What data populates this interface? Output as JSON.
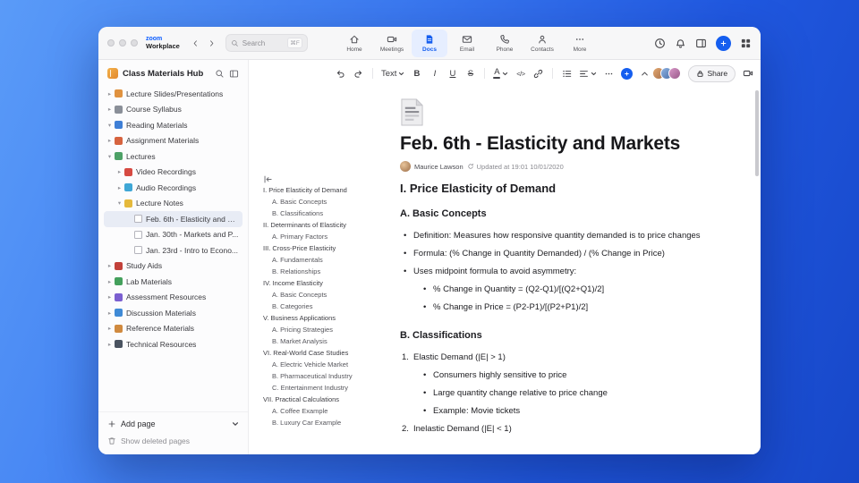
{
  "titlebar": {
    "brand_top": "zoom",
    "brand_bottom": "Workplace",
    "search": {
      "placeholder": "Search",
      "shortcut": "⌘F"
    },
    "tabs": [
      {
        "label": "Home"
      },
      {
        "label": "Meetings"
      },
      {
        "label": "Docs"
      },
      {
        "label": "Email"
      },
      {
        "label": "Phone"
      },
      {
        "label": "Contacts"
      },
      {
        "label": "More"
      }
    ]
  },
  "sidebar": {
    "title": "Class Materials Hub",
    "items": [
      {
        "label": "Lecture Slides/Presentations",
        "level": 0,
        "chevron": "collapsed",
        "icon": "presentation",
        "icon_color": "#e0923f",
        "selected": false
      },
      {
        "label": "Course Syllabus",
        "level": 0,
        "chevron": "collapsed",
        "icon": "syllabus",
        "icon_color": "#8a8f98",
        "selected": false
      },
      {
        "label": "Reading Materials",
        "level": 0,
        "chevron": "expanded",
        "icon": "reading-book",
        "icon_color": "#3f7fd6",
        "selected": false
      },
      {
        "label": "Assignment Materials",
        "level": 0,
        "chevron": "collapsed",
        "icon": "assignment",
        "icon_color": "#d6633f",
        "selected": false
      },
      {
        "label": "Lectures",
        "level": 0,
        "chevron": "expanded",
        "icon": "lectures",
        "icon_color": "#4da167",
        "selected": false
      },
      {
        "label": "Video Recordings",
        "level": 1,
        "chevron": "collapsed",
        "icon": "video",
        "icon_color": "#d64a42",
        "selected": false
      },
      {
        "label": "Audio Recordings",
        "level": 1,
        "chevron": "collapsed",
        "icon": "audio",
        "icon_color": "#3fa7d6",
        "selected": false
      },
      {
        "label": "Lecture Notes",
        "level": 1,
        "chevron": "expanded",
        "icon": "notes",
        "icon_color": "#e5b93c",
        "selected": false
      },
      {
        "label": "Feb. 6th - Elasticity and M...",
        "level": 2,
        "chevron": "none",
        "icon": "page",
        "icon_color": "#ffffff",
        "selected": true
      },
      {
        "label": "Jan. 30th - Markets and P...",
        "level": 2,
        "chevron": "none",
        "icon": "page",
        "icon_color": "#ffffff",
        "selected": false
      },
      {
        "label": "Jan. 23rd - Intro to Econo...",
        "level": 2,
        "chevron": "none",
        "icon": "page",
        "icon_color": "#ffffff",
        "selected": false
      },
      {
        "label": "Study Aids",
        "level": 0,
        "chevron": "collapsed",
        "icon": "study-aids",
        "icon_color": "#c2413a",
        "selected": false
      },
      {
        "label": "Lab Materials",
        "level": 0,
        "chevron": "collapsed",
        "icon": "lab",
        "icon_color": "#44a05c",
        "selected": false
      },
      {
        "label": "Assessment Resources",
        "level": 0,
        "chevron": "collapsed",
        "icon": "assessment",
        "icon_color": "#7b5fd0",
        "selected": false
      },
      {
        "label": "Discussion Materials",
        "level": 0,
        "chevron": "collapsed",
        "icon": "discussion",
        "icon_color": "#3f8ad6",
        "selected": false
      },
      {
        "label": "Reference Materials",
        "level": 0,
        "chevron": "collapsed",
        "icon": "reference",
        "icon_color": "#d08a3f",
        "selected": false
      },
      {
        "label": "Technical Resources",
        "level": 0,
        "chevron": "collapsed",
        "icon": "technical",
        "icon_color": "#4a5360",
        "selected": false
      }
    ],
    "add_page_label": "Add page",
    "show_deleted_label": "Show deleted pages"
  },
  "toolbar": {
    "text_style_label": "Text",
    "format": {
      "bold": "B",
      "italic": "I",
      "underline": "U",
      "strike": "S",
      "color": "A",
      "code": "</>"
    },
    "share_label": "Share"
  },
  "doc": {
    "title": "Feb. 6th - Elasticity and Markets",
    "author": "Maurice Lawson",
    "updated": "Updated at 19:01 10/01/2020",
    "outline": [
      {
        "label": "I. Price Elasticity of Demand",
        "level": 0
      },
      {
        "label": "A. Basic Concepts",
        "level": 1
      },
      {
        "label": "B. Classifications",
        "level": 1
      },
      {
        "label": "II. Determinants of Elasticity",
        "level": 0
      },
      {
        "label": "A. Primary Factors",
        "level": 1
      },
      {
        "label": "III. Cross-Price Elasticity",
        "level": 0
      },
      {
        "label": "A. Fundamentals",
        "level": 1
      },
      {
        "label": "B. Relationships",
        "level": 1
      },
      {
        "label": "IV. Income Elasticity",
        "level": 0
      },
      {
        "label": "A. Basic Concepts",
        "level": 1
      },
      {
        "label": "B. Categories",
        "level": 1
      },
      {
        "label": "V. Business Applications",
        "level": 0
      },
      {
        "label": "A. Pricing Strategies",
        "level": 1
      },
      {
        "label": "B. Market Analysis",
        "level": 1
      },
      {
        "label": "VI. Real-World Case Studies",
        "level": 0
      },
      {
        "label": "A. Electric Vehicle Market",
        "level": 1
      },
      {
        "label": "B. Pharmaceutical Industry",
        "level": 1
      },
      {
        "label": "C. Entertainment Industry",
        "level": 1
      },
      {
        "label": "VII. Practical Calculations",
        "level": 0
      },
      {
        "label": "A. Coffee Example",
        "level": 1
      },
      {
        "label": "B. Luxury Car Example",
        "level": 1
      }
    ],
    "blocks": [
      {
        "type": "h2",
        "text": "I. Price Elasticity of Demand"
      },
      {
        "type": "h3",
        "text": "A. Basic Concepts"
      },
      {
        "type": "bullet",
        "level": 0,
        "text": "Definition: Measures how responsive quantity demanded is to price changes"
      },
      {
        "type": "bullet",
        "level": 0,
        "text": "Formula: (% Change in Quantity Demanded) / (% Change in Price)"
      },
      {
        "type": "bullet",
        "level": 0,
        "text": "Uses midpoint formula to avoid asymmetry:"
      },
      {
        "type": "bullet",
        "level": 1,
        "text": "% Change in Quantity = (Q2-Q1)/[(Q2+Q1)/2]"
      },
      {
        "type": "bullet",
        "level": 1,
        "text": "% Change in Price = (P2-P1)/[(P2+P1)/2]"
      },
      {
        "type": "h3",
        "text": "B. Classifications"
      },
      {
        "type": "number",
        "num": "1.",
        "text": "Elastic Demand (|E| > 1)"
      },
      {
        "type": "bullet",
        "level": 1,
        "text": "Consumers highly sensitive to price"
      },
      {
        "type": "bullet",
        "level": 1,
        "text": "Large quantity change relative to price change"
      },
      {
        "type": "bullet",
        "level": 1,
        "text": "Example: Movie tickets"
      },
      {
        "type": "number",
        "num": "2.",
        "text": "Inelastic Demand (|E| < 1)"
      }
    ],
    "accent_color": "#155eef"
  }
}
